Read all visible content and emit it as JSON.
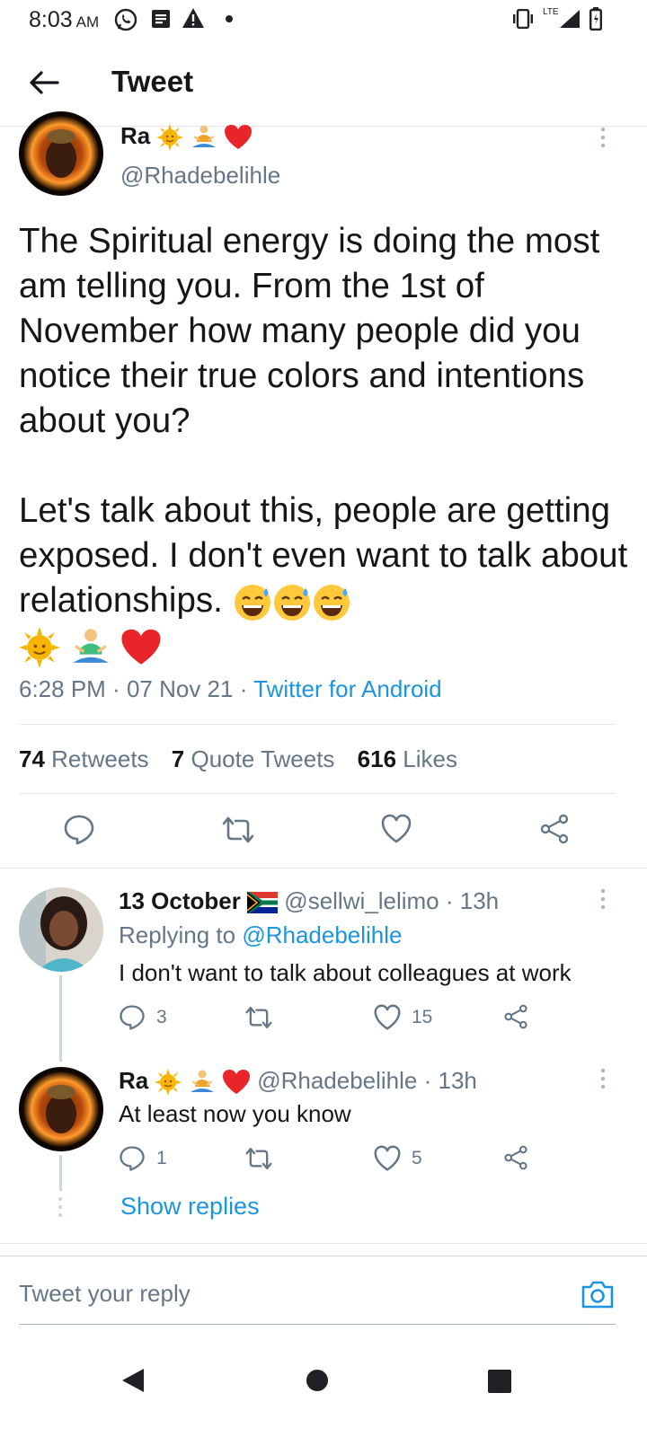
{
  "status_bar": {
    "time": "8:03",
    "ampm": "AM",
    "network": "LTE"
  },
  "header": {
    "title": "Tweet"
  },
  "main_tweet": {
    "name": "Ra",
    "name_emojis": [
      "sun-face",
      "person-lotus",
      "red-heart"
    ],
    "handle": "@Rhadebelihle",
    "text_p1": "The Spiritual energy is doing the most am telling you. From the 1st of November how many people did you notice their true colors and intentions about you?",
    "text_p2": "Let's talk about this, people are getting exposed. I don't even want to talk about relationships.",
    "time": "6:28 PM",
    "date": "07 Nov 21",
    "source": "Twitter for Android",
    "retweets_count": "74",
    "retweets_label": "Retweets",
    "quotes_count": "7",
    "quotes_label": "Quote Tweets",
    "likes_count": "616",
    "likes_label": "Likes"
  },
  "replies": [
    {
      "name": "13 October",
      "flag": "south-africa-flag",
      "handle": "@sellwi_lelimo",
      "time": "· 13h",
      "replying_label": "Replying to",
      "replying_to": "@Rhadebelihle",
      "text": "I don't want to talk about colleagues at work",
      "reply_count": "3",
      "retweet_count": "",
      "like_count": "15"
    },
    {
      "name": "Ra",
      "handle": "@Rhadebelihle",
      "time": "· 13h",
      "text": "At least now you know",
      "reply_count": "1",
      "retweet_count": "",
      "like_count": "5"
    }
  ],
  "show_replies": "Show replies",
  "reply_box": {
    "placeholder": "Tweet your reply"
  },
  "colors": {
    "link": "#1b95e0",
    "secondary_text": "#657786",
    "divider": "#e1e8ed"
  }
}
